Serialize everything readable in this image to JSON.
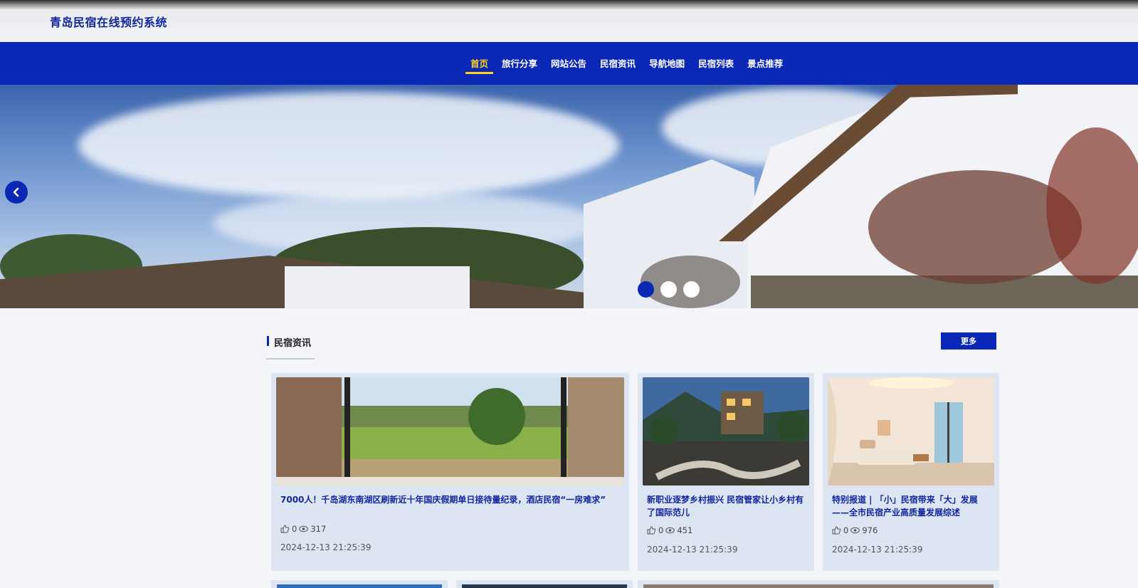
{
  "header": {
    "site_title": "青岛民宿在线预约系统"
  },
  "nav": {
    "items": [
      {
        "label": "首页",
        "active": true
      },
      {
        "label": "旅行分享",
        "active": false
      },
      {
        "label": "网站公告",
        "active": false
      },
      {
        "label": "民宿资讯",
        "active": false
      },
      {
        "label": "导航地图",
        "active": false
      },
      {
        "label": "民宿列表",
        "active": false
      },
      {
        "label": "景点推荐",
        "active": false
      }
    ]
  },
  "banner": {
    "slide_count": 3,
    "active_slide": 1,
    "prev_icon": "chevron-left-icon"
  },
  "section": {
    "title": "民宿资讯",
    "more_label": "更多"
  },
  "news": [
    {
      "title": "7000人！千岛湖东南湖区刷新近十年国庆假期单日接待量纪录，酒店民宿“一房难求”",
      "likes": "0",
      "views": "317",
      "date": "2024-12-13 21:25:39"
    },
    {
      "title": "新职业逐梦乡村振兴 民宿管家让小乡村有了国际范儿",
      "likes": "0",
      "views": "451",
      "date": "2024-12-13 21:25:39"
    },
    {
      "title": "特别报道 | 「小」民宿带来「大」发展——全市民宿产业高质量发展综述",
      "likes": "0",
      "views": "976",
      "date": "2024-12-13 21:25:39"
    }
  ],
  "colors": {
    "primary": "#0a27b5",
    "nav_active": "#ffd21c",
    "card_bg": "#dde5f3",
    "title_text": "#12279c"
  }
}
